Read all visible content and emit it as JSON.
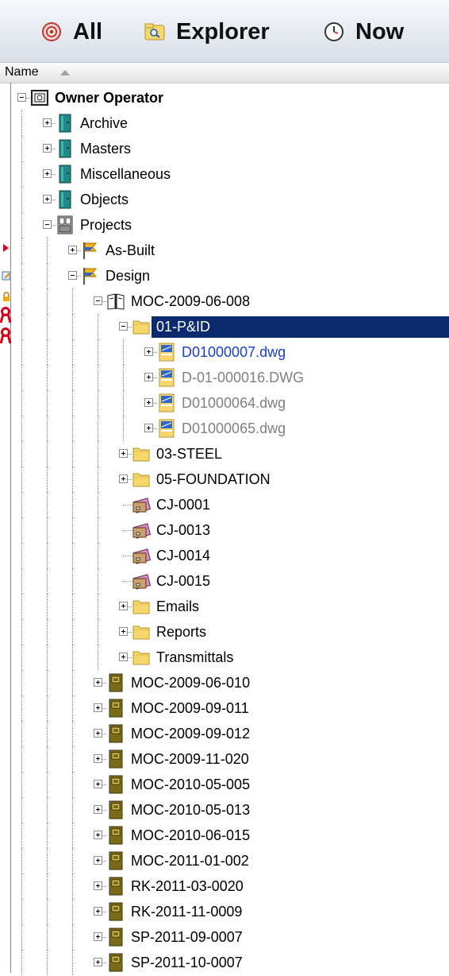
{
  "toolbar": {
    "all_label": "All",
    "explorer_label": "Explorer",
    "now_label": "Now",
    "all_icon": "target-icon",
    "explorer_icon": "folder-search-icon",
    "now_icon": "clock-icon"
  },
  "header": {
    "name_label": "Name",
    "sort": "ascending"
  },
  "colors": {
    "selection": "#0c2a6e",
    "link_blue": "#1a3cd8",
    "disabled_gray": "#808080",
    "cabinet_teal": "#1f8a86",
    "project_olive": "#7a6a1a",
    "folder_yellow": "#f5d76e"
  },
  "tree": {
    "items": [
      {
        "label": "Owner Operator",
        "icon": "vault-icon",
        "expander": "minus",
        "style": "bold"
      },
      {
        "label": "Archive",
        "icon": "cabinet-icon",
        "expander": "plus"
      },
      {
        "label": "Masters",
        "icon": "cabinet-icon",
        "expander": "plus"
      },
      {
        "label": "Miscellaneous",
        "icon": "cabinet-icon",
        "expander": "plus"
      },
      {
        "label": "Objects",
        "icon": "cabinet-icon",
        "expander": "plus"
      },
      {
        "label": "Projects",
        "icon": "projects-cabinet-icon",
        "expander": "minus"
      },
      {
        "label": "As-Built",
        "icon": "flag-icon",
        "expander": "plus"
      },
      {
        "label": "Design",
        "icon": "flag-icon",
        "expander": "minus"
      },
      {
        "label": "MOC-2009-06-008",
        "icon": "open-book-icon",
        "expander": "minus"
      },
      {
        "label": "01-P&ID",
        "icon": "folder-icon",
        "expander": "minus",
        "selected": true
      },
      {
        "label": "D01000007.dwg",
        "icon": "drawing-file-icon",
        "expander": "plus",
        "style": "blue"
      },
      {
        "label": "D-01-000016.DWG",
        "icon": "drawing-file-icon",
        "expander": "plus",
        "style": "gray"
      },
      {
        "label": "D01000064.dwg",
        "icon": "drawing-file-icon",
        "expander": "plus",
        "style": "gray"
      },
      {
        "label": "D01000065.dwg",
        "icon": "drawing-file-icon",
        "expander": "plus",
        "style": "gray"
      },
      {
        "label": "03-STEEL",
        "icon": "folder-icon",
        "expander": "plus"
      },
      {
        "label": "05-FOUNDATION",
        "icon": "folder-icon",
        "expander": "plus"
      },
      {
        "label": "CJ-0001",
        "icon": "change-job-icon",
        "expander": "none"
      },
      {
        "label": "CJ-0013",
        "icon": "change-job-icon",
        "expander": "none"
      },
      {
        "label": "CJ-0014",
        "icon": "change-job-icon",
        "expander": "none"
      },
      {
        "label": "CJ-0015",
        "icon": "change-job-icon",
        "expander": "none"
      },
      {
        "label": "Emails",
        "icon": "folder-icon",
        "expander": "plus"
      },
      {
        "label": "Reports",
        "icon": "folder-icon",
        "expander": "plus"
      },
      {
        "label": "Transmittals",
        "icon": "folder-icon",
        "expander": "plus"
      },
      {
        "label": "MOC-2009-06-010",
        "icon": "project-book-icon",
        "expander": "plus"
      },
      {
        "label": "MOC-2009-09-011",
        "icon": "project-book-icon",
        "expander": "plus"
      },
      {
        "label": "MOC-2009-09-012",
        "icon": "project-book-icon",
        "expander": "plus"
      },
      {
        "label": "MOC-2009-11-020",
        "icon": "project-book-icon",
        "expander": "plus"
      },
      {
        "label": "MOC-2010-05-005",
        "icon": "project-book-icon",
        "expander": "plus"
      },
      {
        "label": "MOC-2010-05-013",
        "icon": "project-book-icon",
        "expander": "plus"
      },
      {
        "label": "MOC-2010-06-015",
        "icon": "project-book-icon",
        "expander": "plus"
      },
      {
        "label": "MOC-2011-01-002",
        "icon": "project-book-icon",
        "expander": "plus"
      },
      {
        "label": "RK-2011-03-0020",
        "icon": "project-book-icon",
        "expander": "plus"
      },
      {
        "label": "RK-2011-11-0009",
        "icon": "project-book-icon",
        "expander": "plus"
      },
      {
        "label": "SP-2011-09-0007",
        "icon": "project-book-icon",
        "expander": "plus"
      },
      {
        "label": "SP-2011-10-0007",
        "icon": "project-book-icon",
        "expander": "plus"
      }
    ]
  },
  "gutter": {
    "icons": [
      "current-row-arrow-icon",
      "edit-note-icon",
      "lock-icon",
      "checkout-ribbon-icon",
      "checkout-ribbon-icon"
    ]
  }
}
